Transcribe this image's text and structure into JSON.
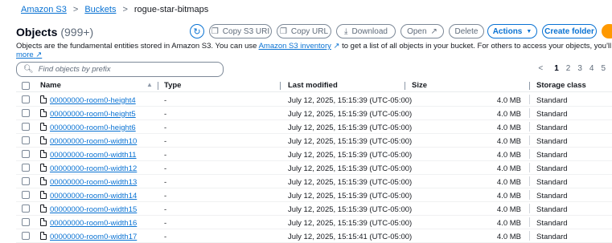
{
  "breadcrumb": {
    "s3": "Amazon S3",
    "buckets": "Buckets",
    "current": "rogue-star-bitmaps",
    "sep1": ">",
    "sep2": ">"
  },
  "header": {
    "title": "Objects",
    "count": "(999+)"
  },
  "toolbar": {
    "copy_s3_uri": "Copy S3 URI",
    "copy_url": "Copy URL",
    "download": "Download",
    "open": "Open",
    "delete": "Delete",
    "actions": "Actions",
    "create_folder": "Create folder"
  },
  "description": {
    "part1": "Objects are the fundamental entities stored in Amazon S3. You can use ",
    "link": "Amazon S3 inventory",
    "part2": " to get a list of all objects in your bucket. For others to access your objects, you'll need to explicitly grant them perm",
    "more": "more"
  },
  "search": {
    "placeholder": "Find objects by prefix"
  },
  "pagination": {
    "prev": "<",
    "pages": [
      "1",
      "2",
      "3",
      "4",
      "5"
    ]
  },
  "table": {
    "headers": {
      "name": "Name",
      "type": "Type",
      "last_modified": "Last modified",
      "size": "Size",
      "storage_class": "Storage class"
    },
    "rows": [
      {
        "name": "00000000-room0-height4",
        "type": "-",
        "modified": "July 12, 2025, 15:15:39 (UTC-05:00)",
        "size": "4.0 MB",
        "storage": "Standard"
      },
      {
        "name": "00000000-room0-height5",
        "type": "-",
        "modified": "July 12, 2025, 15:15:39 (UTC-05:00)",
        "size": "4.0 MB",
        "storage": "Standard"
      },
      {
        "name": "00000000-room0-height6",
        "type": "-",
        "modified": "July 12, 2025, 15:15:39 (UTC-05:00)",
        "size": "4.0 MB",
        "storage": "Standard"
      },
      {
        "name": "00000000-room0-width10",
        "type": "-",
        "modified": "July 12, 2025, 15:15:39 (UTC-05:00)",
        "size": "4.0 MB",
        "storage": "Standard"
      },
      {
        "name": "00000000-room0-width11",
        "type": "-",
        "modified": "July 12, 2025, 15:15:39 (UTC-05:00)",
        "size": "4.0 MB",
        "storage": "Standard"
      },
      {
        "name": "00000000-room0-width12",
        "type": "-",
        "modified": "July 12, 2025, 15:15:39 (UTC-05:00)",
        "size": "4.0 MB",
        "storage": "Standard"
      },
      {
        "name": "00000000-room0-width13",
        "type": "-",
        "modified": "July 12, 2025, 15:15:39 (UTC-05:00)",
        "size": "4.0 MB",
        "storage": "Standard"
      },
      {
        "name": "00000000-room0-width14",
        "type": "-",
        "modified": "July 12, 2025, 15:15:39 (UTC-05:00)",
        "size": "4.0 MB",
        "storage": "Standard"
      },
      {
        "name": "00000000-room0-width15",
        "type": "-",
        "modified": "July 12, 2025, 15:15:39 (UTC-05:00)",
        "size": "4.0 MB",
        "storage": "Standard"
      },
      {
        "name": "00000000-room0-width16",
        "type": "-",
        "modified": "July 12, 2025, 15:15:39 (UTC-05:00)",
        "size": "4.0 MB",
        "storage": "Standard"
      },
      {
        "name": "00000000-room0-width17",
        "type": "-",
        "modified": "July 12, 2025, 15:15:41 (UTC-05:00)",
        "size": "4.0 MB",
        "storage": "Standard"
      }
    ]
  },
  "colors": {
    "link": "#0972d3",
    "accent_orange": "#ff9900",
    "text": "#16191f",
    "muted": "#5f6b7a"
  }
}
